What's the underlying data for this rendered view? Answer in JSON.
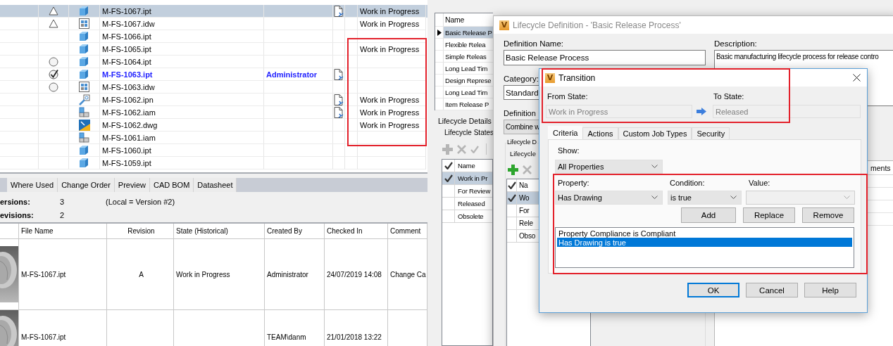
{
  "vault": {
    "files": [
      {
        "name": "M-FS-1067.ipt",
        "status": {
          "kind": "triangle"
        },
        "kind": "part",
        "checked_out": false,
        "has_document": true,
        "state": "Work in Progress",
        "selected": true
      },
      {
        "name": "M-FS-1067.idw",
        "status": {
          "kind": "triangle"
        },
        "kind": "drawing",
        "checked_out": false,
        "has_document": false,
        "state": "Work in Progress",
        "selected": false
      },
      {
        "name": "M-FS-1066.ipt",
        "kind": "part",
        "checked_out": false,
        "has_document": false,
        "selected": false
      },
      {
        "name": "M-FS-1065.ipt",
        "kind": "part",
        "checked_out": false,
        "has_document": false,
        "state": "Work in Progress",
        "selected": false
      },
      {
        "name": "M-FS-1064.ipt",
        "status": {
          "kind": "circle"
        },
        "kind": "part",
        "checked_out": false,
        "has_document": false,
        "selected": false
      },
      {
        "name": "M-FS-1063.ipt",
        "status": {
          "kind": "check"
        },
        "kind": "part",
        "checked_out": true,
        "checked_out_by": "Administrator",
        "has_document": true,
        "selected": false
      },
      {
        "name": "M-FS-1063.idw",
        "status": {
          "kind": "circle"
        },
        "kind": "drawing",
        "checked_out": false,
        "has_document": false,
        "selected": false
      },
      {
        "name": "M-FS-1062.ipn",
        "kind": "presentation",
        "checked_out": false,
        "has_document": true,
        "state": "Work in Progress",
        "selected": false
      },
      {
        "name": "M-FS-1062.iam",
        "kind": "assembly",
        "checked_out": false,
        "has_document": true,
        "state": "Work in Progress",
        "selected": false
      },
      {
        "name": "M-FS-1062.dwg",
        "kind": "dwg",
        "checked_out": false,
        "has_document": false,
        "state": "Work in Progress",
        "selected": false
      },
      {
        "name": "M-FS-1061.iam",
        "kind": "assembly",
        "checked_out": false,
        "has_document": false,
        "selected": false
      },
      {
        "name": "M-FS-1060.ipt",
        "kind": "part",
        "checked_out": false,
        "has_document": false,
        "selected": false
      },
      {
        "name": "M-FS-1059.ipt",
        "kind": "part",
        "checked_out": false,
        "has_document": false,
        "selected": false
      }
    ],
    "tabs": [
      {
        "label": "Where Used",
        "selected": false
      },
      {
        "label": "Change Order",
        "selected": false
      },
      {
        "label": "Preview",
        "selected": false
      },
      {
        "label": "CAD BOM",
        "selected": false
      },
      {
        "label": "Datasheet",
        "selected": false
      }
    ],
    "versions_label": "ersions:",
    "versions_value": "3",
    "local_note": "(Local = Version #2)",
    "revisions_label": "evisions:",
    "revisions_value": "2",
    "history": {
      "columns": [
        "File Name",
        "Revision",
        "State (Historical)",
        "Created By",
        "Checked In",
        "Comment"
      ],
      "rows": [
        {
          "file_name": "M-FS-1067.ipt",
          "revision": "A",
          "state": "Work in Progress",
          "created_by": "Administrator",
          "checked_in": "24/07/2019 14:08",
          "comment": "Change Ca"
        },
        {
          "file_name": "M-FS-1067.ipt",
          "created_by": "TEAM\\danm",
          "checked_in": "21/01/2018 13:22"
        }
      ]
    }
  },
  "lifecycles": {
    "header": "Name",
    "items": [
      {
        "label": "Basic Release P",
        "selected": true
      },
      {
        "label": "Flexible Relea",
        "selected": false
      },
      {
        "label": "Simple Releas",
        "selected": false
      },
      {
        "label": "Long Lead Tim",
        "selected": false
      },
      {
        "label": "Design Represe",
        "selected": false
      },
      {
        "label": "Long Lead Tim",
        "selected": false
      },
      {
        "label": "Item Release P",
        "selected": false
      }
    ],
    "details_label": "Lifecycle Details",
    "states_label": "Lifecycle States",
    "states_header": "Name",
    "states": [
      {
        "label": "Work in Pr",
        "checked": true,
        "selected": true
      },
      {
        "label": "For Review",
        "checked": false,
        "selected": false
      },
      {
        "label": "Released",
        "checked": false,
        "selected": false
      },
      {
        "label": "Obsolete",
        "checked": false,
        "selected": false
      }
    ]
  },
  "definition": {
    "logo": "V",
    "title": "Lifecycle Definition - 'Basic Release Process'",
    "name_label": "Definition Name:",
    "name_value": "Basic Release Process",
    "description_label": "Description:",
    "description_value": "Basic manufacturing lifecycle process for release contro",
    "category_label": "Category:",
    "category_value": "Standard",
    "definition_label": "Definition",
    "combine_label": "Combine w",
    "group_label": "Lifecycle D",
    "states_label": "Lifecycle",
    "states_header": "Na",
    "states": [
      {
        "label": "Wo",
        "checked": true,
        "selected": true
      },
      {
        "label": "For",
        "checked": false,
        "selected": false
      },
      {
        "label": "Rele",
        "checked": false,
        "selected": false
      },
      {
        "label": "Obso",
        "checked": false,
        "selected": false
      }
    ],
    "comments_header": "ments"
  },
  "transition": {
    "logo": "V",
    "title": "Transition",
    "from_label": "From State:",
    "from_value": "Work in Progress",
    "to_label": "To State:",
    "to_value": "Released",
    "tabs": [
      {
        "label": "Criteria",
        "selected": true
      },
      {
        "label": "Actions",
        "selected": false
      },
      {
        "label": "Custom Job Types",
        "selected": false
      },
      {
        "label": "Security",
        "selected": false
      }
    ],
    "show_label": "Show:",
    "show_value": "All Properties",
    "property_label": "Property:",
    "property_value": "Has Drawing",
    "condition_label": "Condition:",
    "condition_value": "is true",
    "value_label": "Value:",
    "actions": [
      "Add",
      "Replace",
      "Remove"
    ],
    "criteria": [
      {
        "label": "Property Compliance is Compliant",
        "selected": false
      },
      {
        "label": "Has Drawing is true",
        "selected": true
      }
    ],
    "buttons": [
      {
        "label": "OK",
        "default": true
      },
      {
        "label": "Cancel",
        "default": false
      },
      {
        "label": "Help",
        "default": false
      }
    ]
  }
}
